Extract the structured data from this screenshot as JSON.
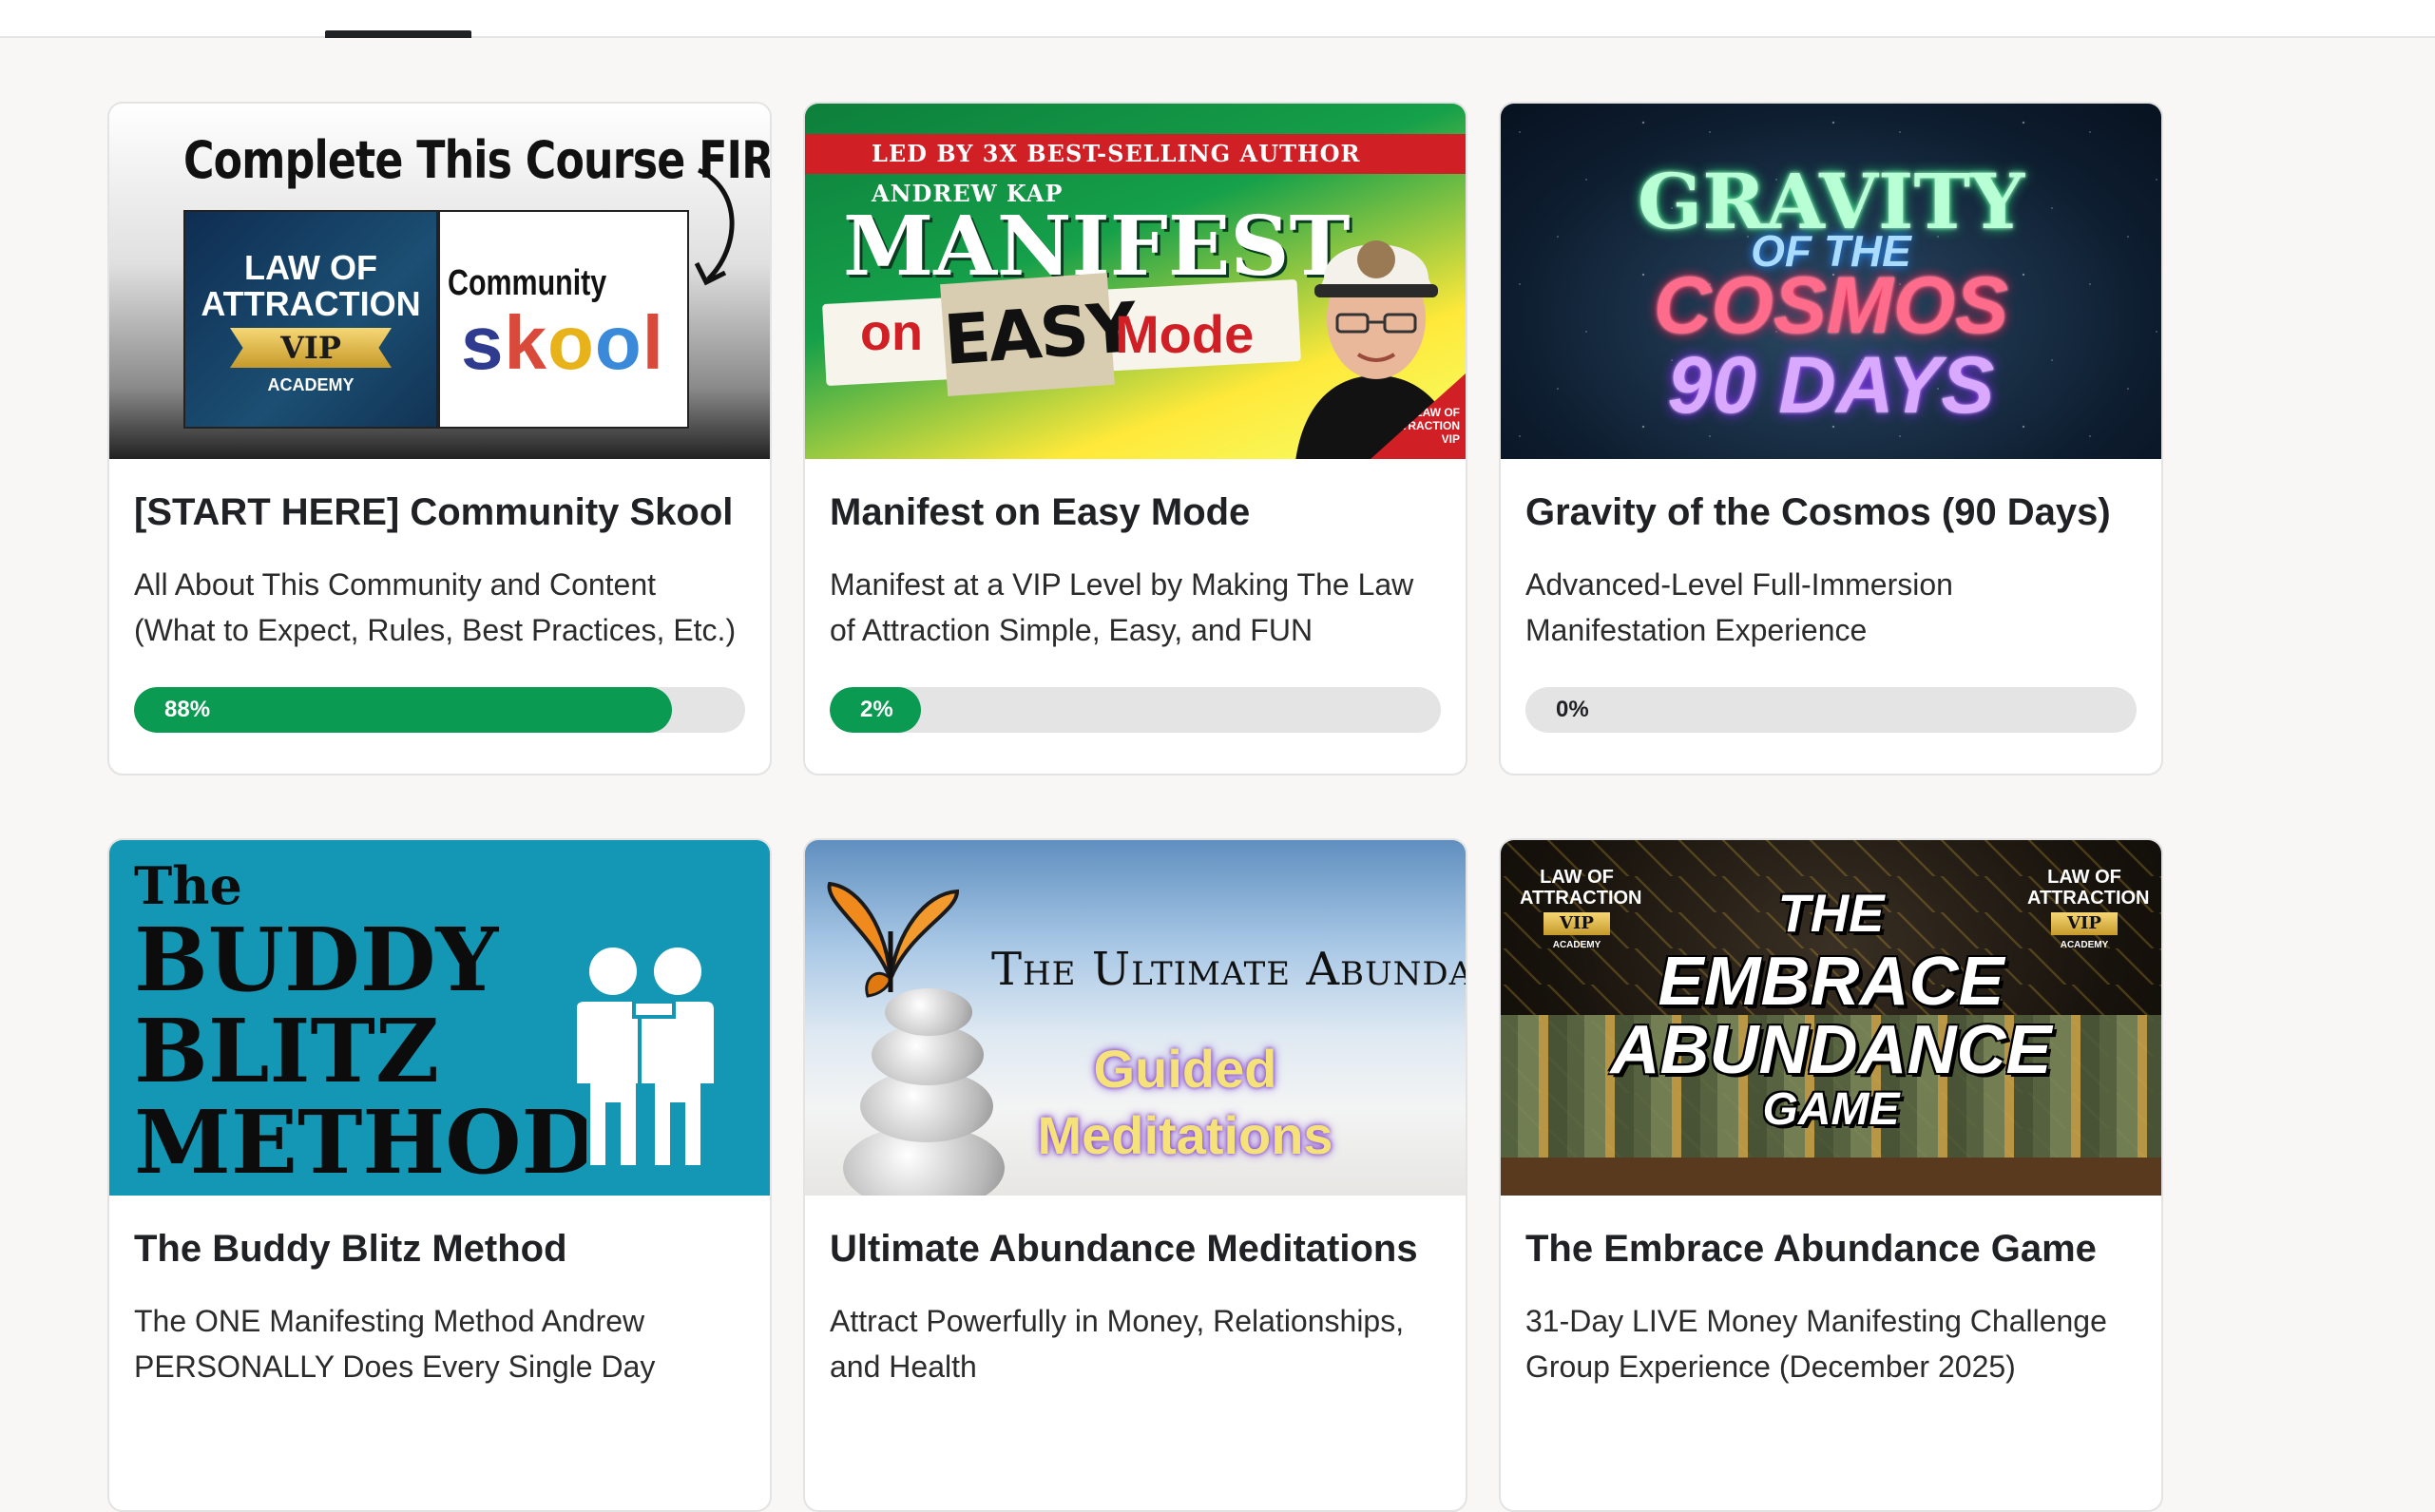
{
  "page": {
    "colors": {
      "background": "#f8f7f5",
      "card": "#ffffff",
      "progress_fill": "#0a9a52",
      "progress_track": "#e4e4e4"
    }
  },
  "courses": [
    {
      "title": "[START HERE] Community Skool",
      "description": "All About This Community and Content (What to Expect, Rules, Best Practices, Etc.)",
      "progress_label": "88%",
      "progress": 0.88,
      "thumb": {
        "headline": "Complete This Course FIRST!",
        "left_line1": "LAW OF",
        "left_line2": "ATTRACTION",
        "vip": "VIP",
        "academy": "ACADEMY",
        "community": "Community",
        "skool": "skool"
      }
    },
    {
      "title": "Manifest on Easy Mode",
      "description": "Manifest at a VIP Level by Making The Law of Attraction Simple, Easy, and FUN",
      "progress_label": "2%",
      "progress": 0.02,
      "thumb": {
        "strip": "LED BY 3X BEST-SELLING AUTHOR ANDREW KAP",
        "manifest": "MANIFEST",
        "on": "on",
        "easy": "EASY",
        "mode": "Mode",
        "badge": "LAW OF ATTRACTION VIP"
      }
    },
    {
      "title": "Gravity of the Cosmos (90 Days)",
      "description": "Advanced-Level Full-Immersion Manifestation Experience",
      "progress_label": "0%",
      "progress": 0,
      "thumb": {
        "line1": "GRAVITY",
        "line2": "OF THE",
        "line3": "COSMOS",
        "line4": "90 DAYS"
      }
    },
    {
      "title": "The Buddy Blitz Method",
      "description": "The ONE Manifesting Method Andrew PERSONALLY Does Every Single Day",
      "thumb": {
        "line1": "The",
        "line2": "BUDDY",
        "line3": "BLITZ",
        "line4": "METHOD"
      }
    },
    {
      "title": "Ultimate Abundance Meditations",
      "description": "Attract Powerfully in Money, Relationships, and Health",
      "thumb": {
        "title": "The Ultimate Abundance",
        "line1": "Guided",
        "line2": "Meditations"
      }
    },
    {
      "title": "The Embrace Abundance Game",
      "description": "31-Day LIVE Money Manifesting Challenge Group Experience (December 2025)",
      "thumb": {
        "line1": "THE",
        "line2": "EMBRACE",
        "line3": "ABUNDANCE",
        "line4": "GAME",
        "badge_line1": "LAW OF",
        "badge_line2": "ATTRACTION",
        "badge_vip": "VIP",
        "badge_academy": "ACADEMY"
      }
    }
  ]
}
